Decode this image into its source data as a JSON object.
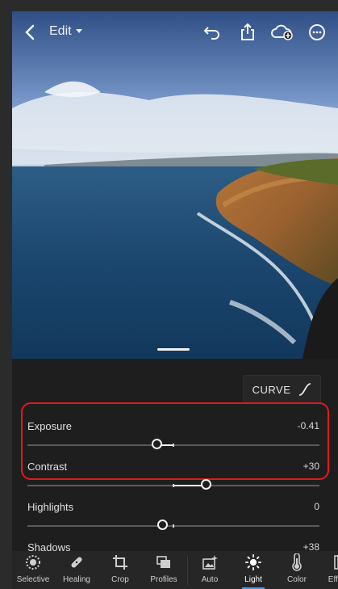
{
  "toolbar": {
    "edit_label": "Edit",
    "icons": [
      "back-chevron-icon",
      "undo-icon",
      "share-icon",
      "cloud-add-icon",
      "more-icon"
    ]
  },
  "panel": {
    "curve_label": "CURVE",
    "sliders": [
      {
        "name": "Exposure",
        "value": "-0.41",
        "level": -0.041
      },
      {
        "name": "Contrast",
        "value": "+30",
        "level": 0.3
      },
      {
        "name": "Highlights",
        "value": "0",
        "level": 0
      },
      {
        "name": "Shadows",
        "value": "+38",
        "level": 0.38
      }
    ]
  },
  "tools": [
    {
      "label": "Selective",
      "icon": "selective-icon"
    },
    {
      "label": "Healing",
      "icon": "bandage-icon"
    },
    {
      "label": "Crop",
      "icon": "crop-icon"
    },
    {
      "label": "Profiles",
      "icon": "profiles-icon"
    },
    {
      "label": "Auto",
      "icon": "auto-icon"
    },
    {
      "label": "Light",
      "icon": "sun-icon",
      "active": true
    },
    {
      "label": "Color",
      "icon": "thermometer-icon"
    },
    {
      "label": "Effects",
      "icon": "effects-icon"
    }
  ],
  "colors": {
    "highlight_box": "#e11a1a",
    "active_underline": "#3aa0ff",
    "panel_bg": "#1e1e1e"
  }
}
